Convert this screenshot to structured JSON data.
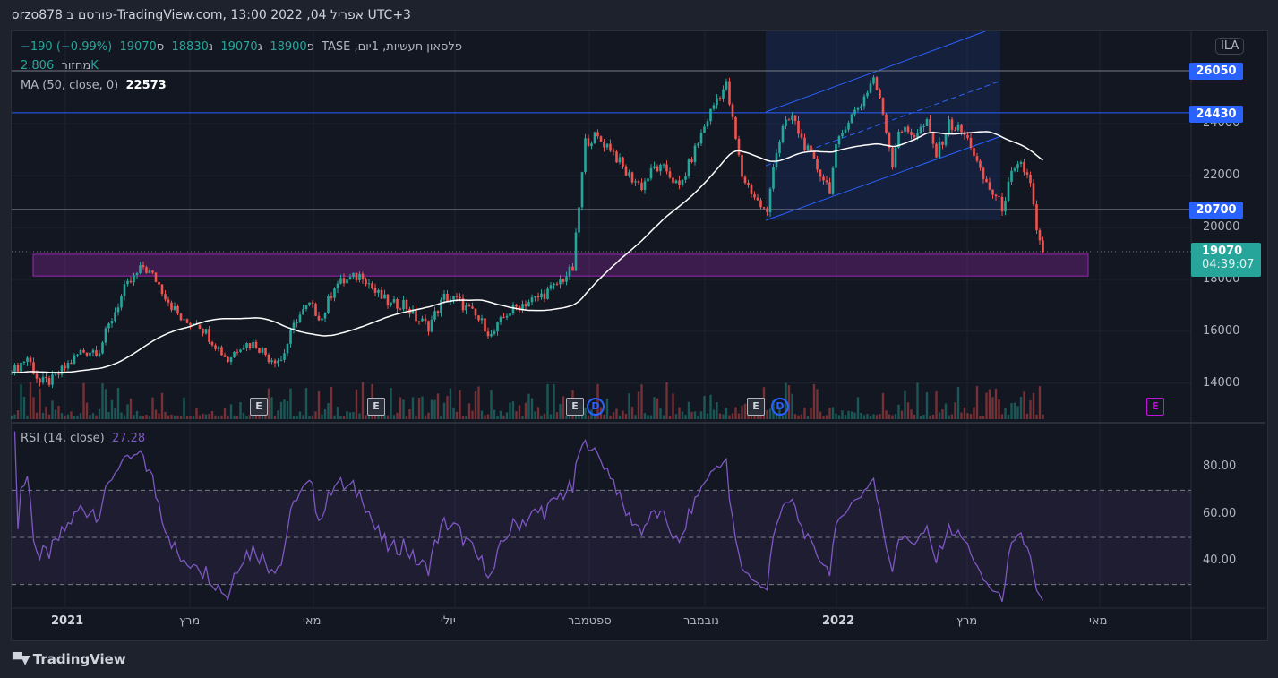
{
  "header": {
    "title": "orzo878 פורסם ב-TradingView.com, 13:00 2022 ,04 אפריל UTC+3"
  },
  "legend": {
    "symbol": "פלסאון תעשיות, 1יום, TASE",
    "open_label": "פ",
    "open": "18900",
    "high_label": "ג",
    "high": "19070",
    "low_label": "נ",
    "low": "18830",
    "close_label": "ס",
    "close": "19070",
    "change": "−190 (−0.99%)",
    "volume_label": "מחזור",
    "volume": "2.806K",
    "ma_label": "MA (50, close, 0)",
    "ma_value": "22573",
    "rsi_label": "RSI (14, close)",
    "rsi_value": "27.28"
  },
  "currency": "ILA",
  "price_tags": [
    {
      "value": "26050"
    },
    {
      "value": "24430"
    },
    {
      "value": "20700"
    }
  ],
  "last_price": {
    "value": "19070",
    "countdown": "04:39:07"
  },
  "events": [
    {
      "type": "E"
    },
    {
      "type": "E"
    },
    {
      "type": "E"
    },
    {
      "type": "D"
    },
    {
      "type": "E"
    },
    {
      "type": "D"
    },
    {
      "type": "E"
    }
  ],
  "footer": {
    "brand": "TradingView"
  },
  "colors": {
    "up": "#26a69a",
    "down": "#ef5350",
    "ma": "#ffffff",
    "rsi": "#7e57c2",
    "level": "#2962ff",
    "zone": "#9c27b0"
  },
  "chart_data": {
    "type": "candlestick",
    "series_keypoints": [
      [
        0,
        14400
      ],
      [
        5,
        15000
      ],
      [
        9,
        14000
      ],
      [
        13,
        14100
      ],
      [
        17,
        14600
      ],
      [
        22,
        15200
      ],
      [
        28,
        15300
      ],
      [
        32,
        16500
      ],
      [
        36,
        17600
      ],
      [
        42,
        18500
      ],
      [
        46,
        18000
      ],
      [
        51,
        17000
      ],
      [
        55,
        16300
      ],
      [
        59,
        16400
      ],
      [
        63,
        15800
      ],
      [
        69,
        14900
      ],
      [
        73,
        15500
      ],
      [
        78,
        15500
      ],
      [
        82,
        15000
      ],
      [
        86,
        14900
      ],
      [
        91,
        16500
      ],
      [
        95,
        17000
      ],
      [
        99,
        16500
      ],
      [
        103,
        17800
      ],
      [
        108,
        18000
      ],
      [
        112,
        18200
      ],
      [
        116,
        17500
      ],
      [
        121,
        17000
      ],
      [
        125,
        17100
      ],
      [
        129,
        16500
      ],
      [
        133,
        16200
      ],
      [
        138,
        17300
      ],
      [
        142,
        17200
      ],
      [
        146,
        16800
      ],
      [
        151,
        16200
      ],
      [
        153,
        15800
      ],
      [
        158,
        16700
      ],
      [
        162,
        17000
      ],
      [
        168,
        17300
      ],
      [
        173,
        17700
      ],
      [
        179,
        18400
      ],
      [
        181,
        20800
      ],
      [
        183,
        23300
      ],
      [
        186,
        23500
      ],
      [
        191,
        23100
      ],
      [
        196,
        22100
      ],
      [
        201,
        21600
      ],
      [
        205,
        22300
      ],
      [
        209,
        22200
      ],
      [
        213,
        21500
      ],
      [
        218,
        23000
      ],
      [
        222,
        24200
      ],
      [
        225,
        25000
      ],
      [
        228,
        25500
      ],
      [
        231,
        23400
      ],
      [
        233,
        22000
      ],
      [
        238,
        21000
      ],
      [
        241,
        20500
      ],
      [
        243,
        22500
      ],
      [
        246,
        23800
      ],
      [
        249,
        24300
      ],
      [
        252,
        23400
      ],
      [
        256,
        22500
      ],
      [
        261,
        21500
      ],
      [
        263,
        23000
      ],
      [
        266,
        24000
      ],
      [
        271,
        24800
      ],
      [
        275,
        25800
      ],
      [
        278,
        24400
      ],
      [
        281,
        22500
      ],
      [
        283,
        23800
      ],
      [
        288,
        23600
      ],
      [
        292,
        24000
      ],
      [
        295,
        22800
      ],
      [
        299,
        24000
      ],
      [
        303,
        23700
      ],
      [
        306,
        23200
      ],
      [
        309,
        22100
      ],
      [
        312,
        21500
      ],
      [
        316,
        20800
      ],
      [
        319,
        22000
      ],
      [
        322,
        22400
      ],
      [
        325,
        21800
      ],
      [
        327,
        19800
      ],
      [
        329,
        19070
      ]
    ],
    "x_tick_labels": [
      "2021",
      "מרץ",
      "מאי",
      "יולי",
      "ספטמבר",
      "נובמבר",
      "2022",
      "מרץ",
      "מאי"
    ],
    "price_ticks": [
      "24000",
      "22000",
      "20000",
      "18000",
      "16000",
      "14000"
    ],
    "price_tick_values": [
      24000,
      22000,
      20000,
      18000,
      16000,
      14000
    ],
    "ylim": [
      13000,
      27600
    ],
    "horizontal_levels": [
      26050,
      24430,
      20700
    ],
    "zone": [
      18200,
      18900
    ],
    "ma_period": 50,
    "rsi": {
      "period": 14,
      "ticks": [
        "80.00",
        "60.00",
        "40.00"
      ],
      "tick_values": [
        80,
        60,
        40
      ],
      "bands": [
        70,
        50,
        30
      ],
      "ylim": [
        20,
        100
      ]
    }
  }
}
